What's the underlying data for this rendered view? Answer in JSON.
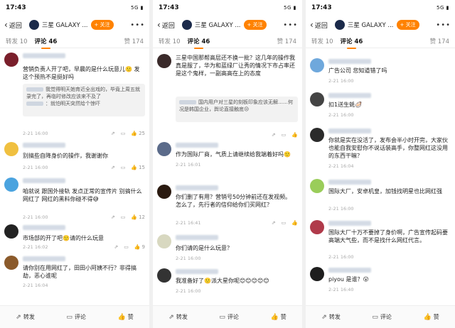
{
  "status": {
    "time": "17:43",
    "right": "5G ▮"
  },
  "nav": {
    "back": "返回",
    "title": "三星 GALAXY ...",
    "follow": "+ 关注",
    "more": "•••"
  },
  "tabs": {
    "repost": "转发 10",
    "comment": "评论 46",
    "like": "赞 174"
  },
  "bottom": {
    "repost": "转发",
    "comment": "评论",
    "like": "赞"
  },
  "colors": {
    "accent": "#ff8200"
  },
  "screens": [
    {
      "comments": [
        {
          "text": "营销负责人开了吧，早晨的是什么玩意儿🙂 发这个预热不是挺好吗",
          "reply1": "我觉得明天她育近全出戏的，毕竟上周五就录完了，再临时修改应该来不及了",
          "reply2": "：就怕明天突然给个惊吓",
          "time": "2-21 16:00",
          "likes": "25"
        },
        {
          "text": "别搞些自降身价的操作，我谢谢你",
          "time": "2-21 16:00",
          "likes": "15"
        },
        {
          "text": "咱就说 跟国外接轨 发点正常的宣传片 别搞什么网红了 网红的黑料你碰不得😅",
          "time": "2-21 16:00",
          "likes": "12"
        },
        {
          "text": "市场部的开了吧🙂请的什么玩意",
          "time": "2-21 16:02",
          "likes": "9"
        },
        {
          "text": "请你别在用网红了，田田小阿姨不行？非得搞劫，恶心谁呢",
          "time": "2-21 16:04",
          "likes": ""
        }
      ]
    },
    {
      "comments": [
        {
          "text": "三星中国那帮高层还不换一批？这几年的操作我真是服了，华为和蓝绿厂让秀的情况下市占率还是这个鬼样，一副高高在上的态度",
          "reply1": "国内用户对三星的刻板印象应该无解……何况是韩国企业，舆论直接触底😒",
          "time": "",
          "likes": ""
        },
        {
          "text": "作为国际厂商，气质上请继续给我端着好吗🙂",
          "time": "2-21 16:01",
          "likes": ""
        },
        {
          "text": "你们删了有用？营销号50分钟前还在发视频。怎么了，先行者的信仰给你们买网红？",
          "time": "2-21 16:41",
          "likes": ""
        },
        {
          "text": "你们请的是什么玩意？",
          "time": "2-21 16:00",
          "likes": ""
        },
        {
          "text": "我准备好了🙂派大星你呢😊😊😊😊😊",
          "time": "2-21 16:00",
          "likes": ""
        }
      ]
    },
    {
      "comments": [
        {
          "text": "广告公司 您知道错了吗",
          "time": "2-21 16:00",
          "likes": ""
        },
        {
          "text": "扣1送生蚝🦪",
          "time": "2-21 16:00",
          "likes": ""
        },
        {
          "text": "你就是实在没活了，发布会半小时开完，大家伙也能自我安慰你不说话装高手，你整网红这没用的东西干嘛？",
          "time": "2-21 16:04",
          "likes": ""
        },
        {
          "text": "国际大厂，安卓机皇，加钱找明星也比网红强",
          "time": "2-21 16:00",
          "likes": ""
        },
        {
          "text": "国际大厂十万不要掉了身价啊，广告宣传起码要高端大气些，而不是找什么网红代言。",
          "time": "2-21 16:00",
          "likes": ""
        },
        {
          "text": "piyou 是谁？😮",
          "time": "2-21 16:40",
          "likes": ""
        }
      ]
    }
  ]
}
